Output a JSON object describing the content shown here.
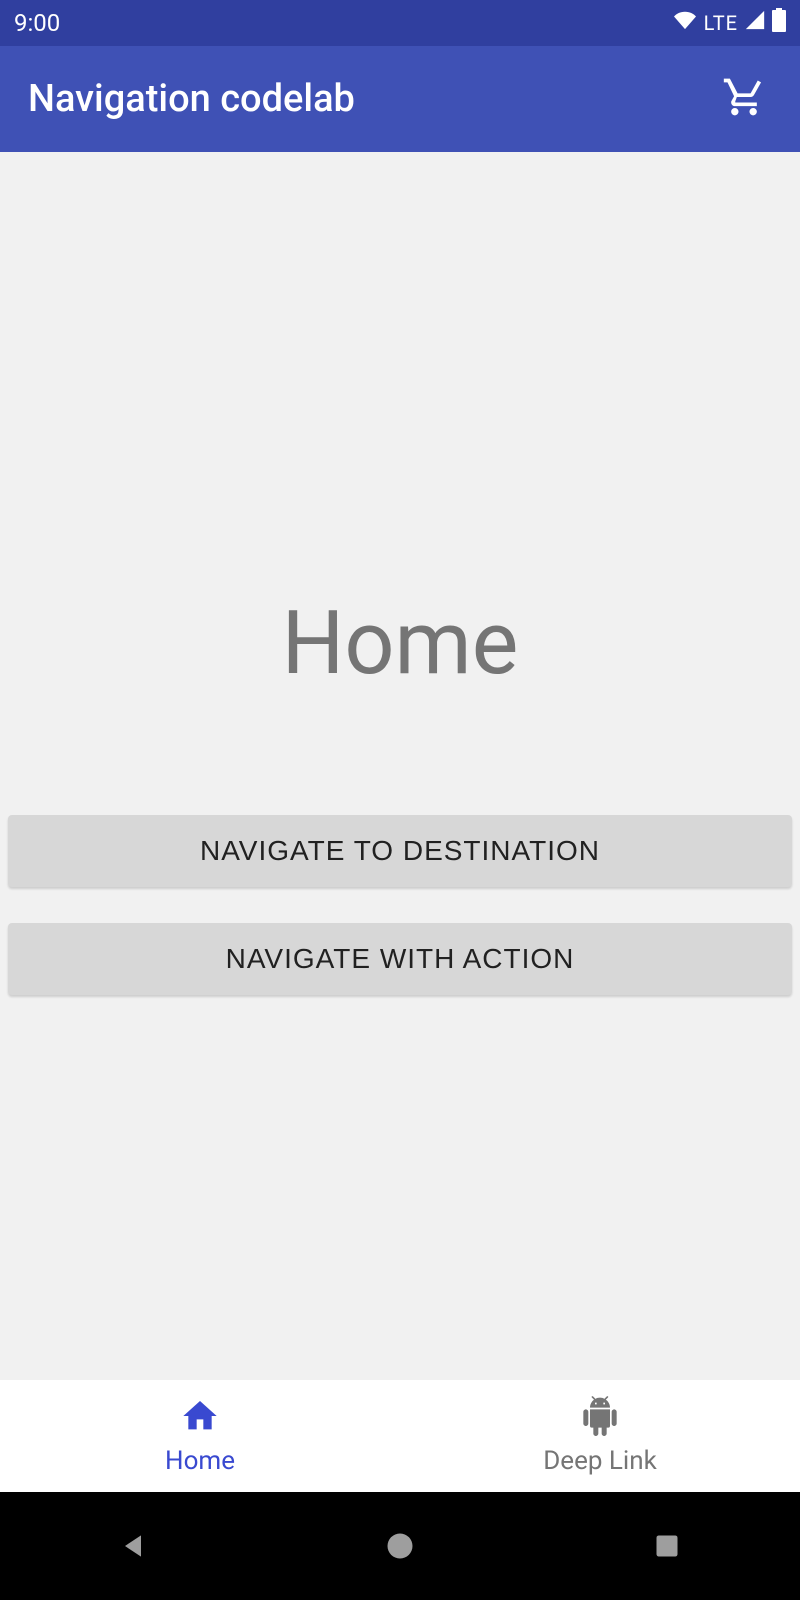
{
  "status_bar": {
    "time": "9:00",
    "network": "LTE"
  },
  "app_bar": {
    "title": "Navigation codelab"
  },
  "main": {
    "title": "Home",
    "button_destination": "NAVIGATE TO DESTINATION",
    "button_action": "NAVIGATE WITH ACTION"
  },
  "bottom_nav": {
    "items": [
      {
        "label": "Home",
        "active": true
      },
      {
        "label": "Deep Link",
        "active": false
      }
    ]
  }
}
